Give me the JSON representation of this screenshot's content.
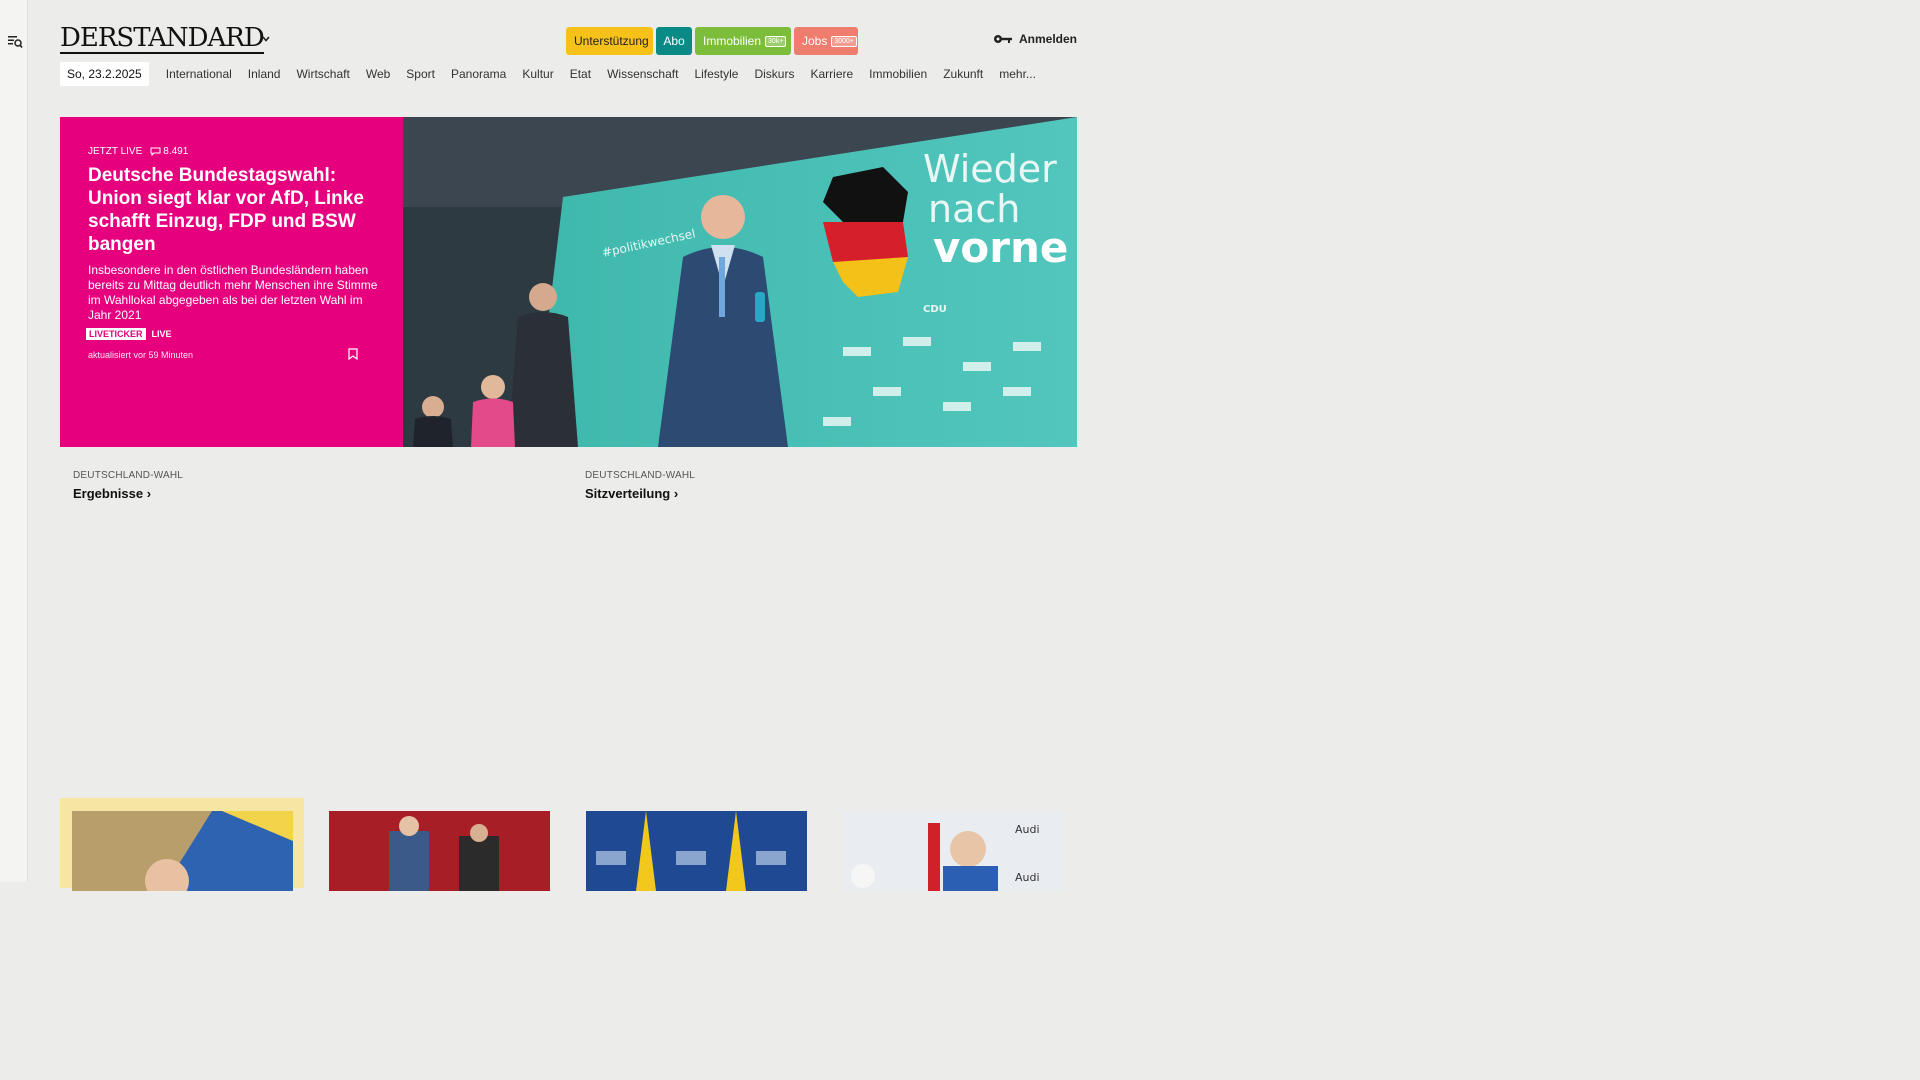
{
  "header": {
    "logo": "DERSTANDARD",
    "pills": {
      "support": "Unterstützung",
      "abo": "Abo",
      "immobilien": "Immobilien",
      "immobilien_tag": "30k+",
      "jobs": "Jobs",
      "jobs_tag": "3000+"
    },
    "login": "Anmelden"
  },
  "nav": {
    "date": "So, 23.2.2025",
    "items": [
      "International",
      "Inland",
      "Wirtschaft",
      "Web",
      "Sport",
      "Panorama",
      "Kultur",
      "Etat",
      "Wissenschaft",
      "Lifestyle",
      "Diskurs",
      "Karriere",
      "Immobilien",
      "Zukunft",
      "mehr..."
    ]
  },
  "hero": {
    "live_label": "JETZT LIVE",
    "comments": "8.491",
    "title": "Deutsche Bundestagswahl: Union siegt klar vor AfD, Linke schafft Einzug, FDP und BSW bangen",
    "subtitle": "Insbesondere in den östlichen Bundesländern haben bereits zu Mittag deutlich mehr Menschen ihre Stimme im Wahllokal abgegeben als bei der letzten Wahl im Jahr 2021",
    "ticker_badge": "LIVETICKER",
    "ticker_live": "LIVE",
    "updated": "aktualisiert vor 59 Minuten",
    "image_slogan_1": "Wieder",
    "image_slogan_2": "nach",
    "image_slogan_3": "vorne",
    "image_hashtag": "#politikwechsel",
    "image_logo_text": "CDU",
    "accent_color": "#e6007e"
  },
  "sublinks": [
    {
      "kicker": "DEUTSCHLAND-WAHL",
      "title": "Ergebnisse ›"
    },
    {
      "kicker": "DEUTSCHLAND-WAHL",
      "title": "Sitzverteilung ›"
    }
  ],
  "cards": {
    "image_labels": {
      "ski_sponsor": "Audi"
    }
  }
}
